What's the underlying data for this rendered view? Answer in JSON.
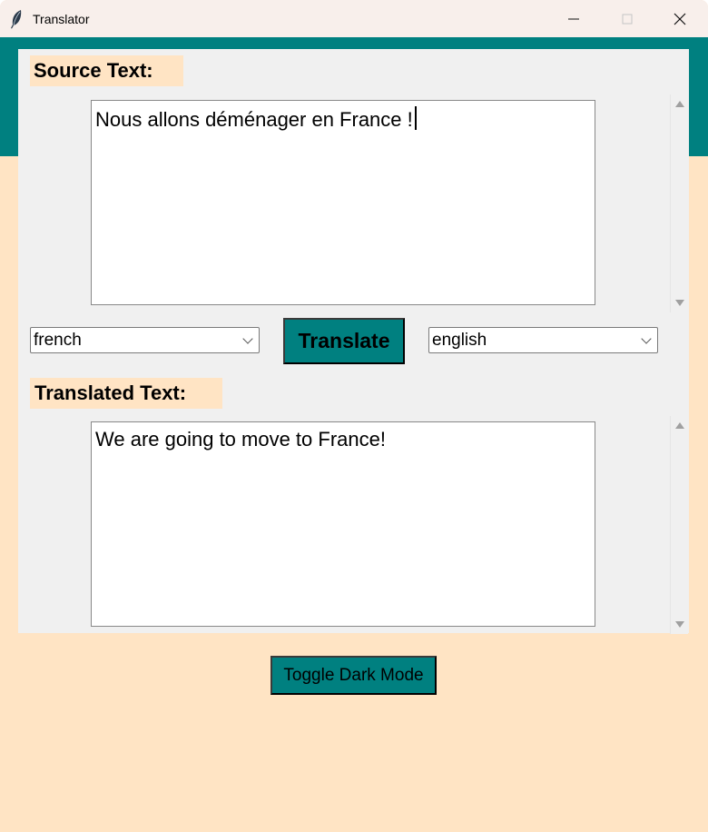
{
  "window": {
    "title": "Translator",
    "minimize_label": "—",
    "close_label": "✕"
  },
  "source": {
    "heading": "Source Text:",
    "text": "Nous allons déménager en France !",
    "language": "french"
  },
  "actions": {
    "translate_label": "Translate",
    "toggle_dark_mode_label": "Toggle Dark Mode"
  },
  "target": {
    "heading": "Translated Text:",
    "text": "We are going to move to France!",
    "language": "english"
  },
  "colors": {
    "accent": "#008080",
    "background": "#ffe4c4",
    "panel": "#f0f0f0",
    "titlebar": "#f8efeb"
  },
  "icons": {
    "app": "feather-icon",
    "minimize": "minimize-icon",
    "maximize": "maximize-icon",
    "close": "close-icon",
    "dropdown": "chevron-down-icon",
    "scroll_up": "scroll-up-arrow-icon",
    "scroll_down": "scroll-down-arrow-icon"
  }
}
